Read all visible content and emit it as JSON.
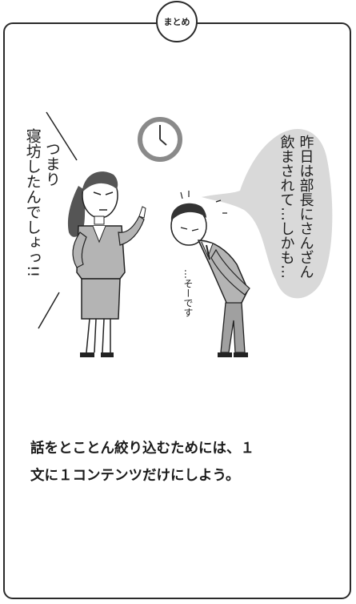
{
  "badge": {
    "label": "まとめ"
  },
  "woman_speech": {
    "line1": "つまり",
    "line2": "寝坊したんでしょっ!!"
  },
  "man_thought": {
    "line1": "昨日は部長にさんざん",
    "line2": "飲まされて…しかも…"
  },
  "man_reply": {
    "text": "…そーです"
  },
  "summary": {
    "line1": "話をとことん絞り込むためには、１",
    "line2": "文に１コンテンツだけにしよう。"
  },
  "colors": {
    "border": "#2a2a2a",
    "suit_gray": "#b4b4b4",
    "bubble_gray": "#d9d9d9",
    "text": "#1a1a1a"
  }
}
